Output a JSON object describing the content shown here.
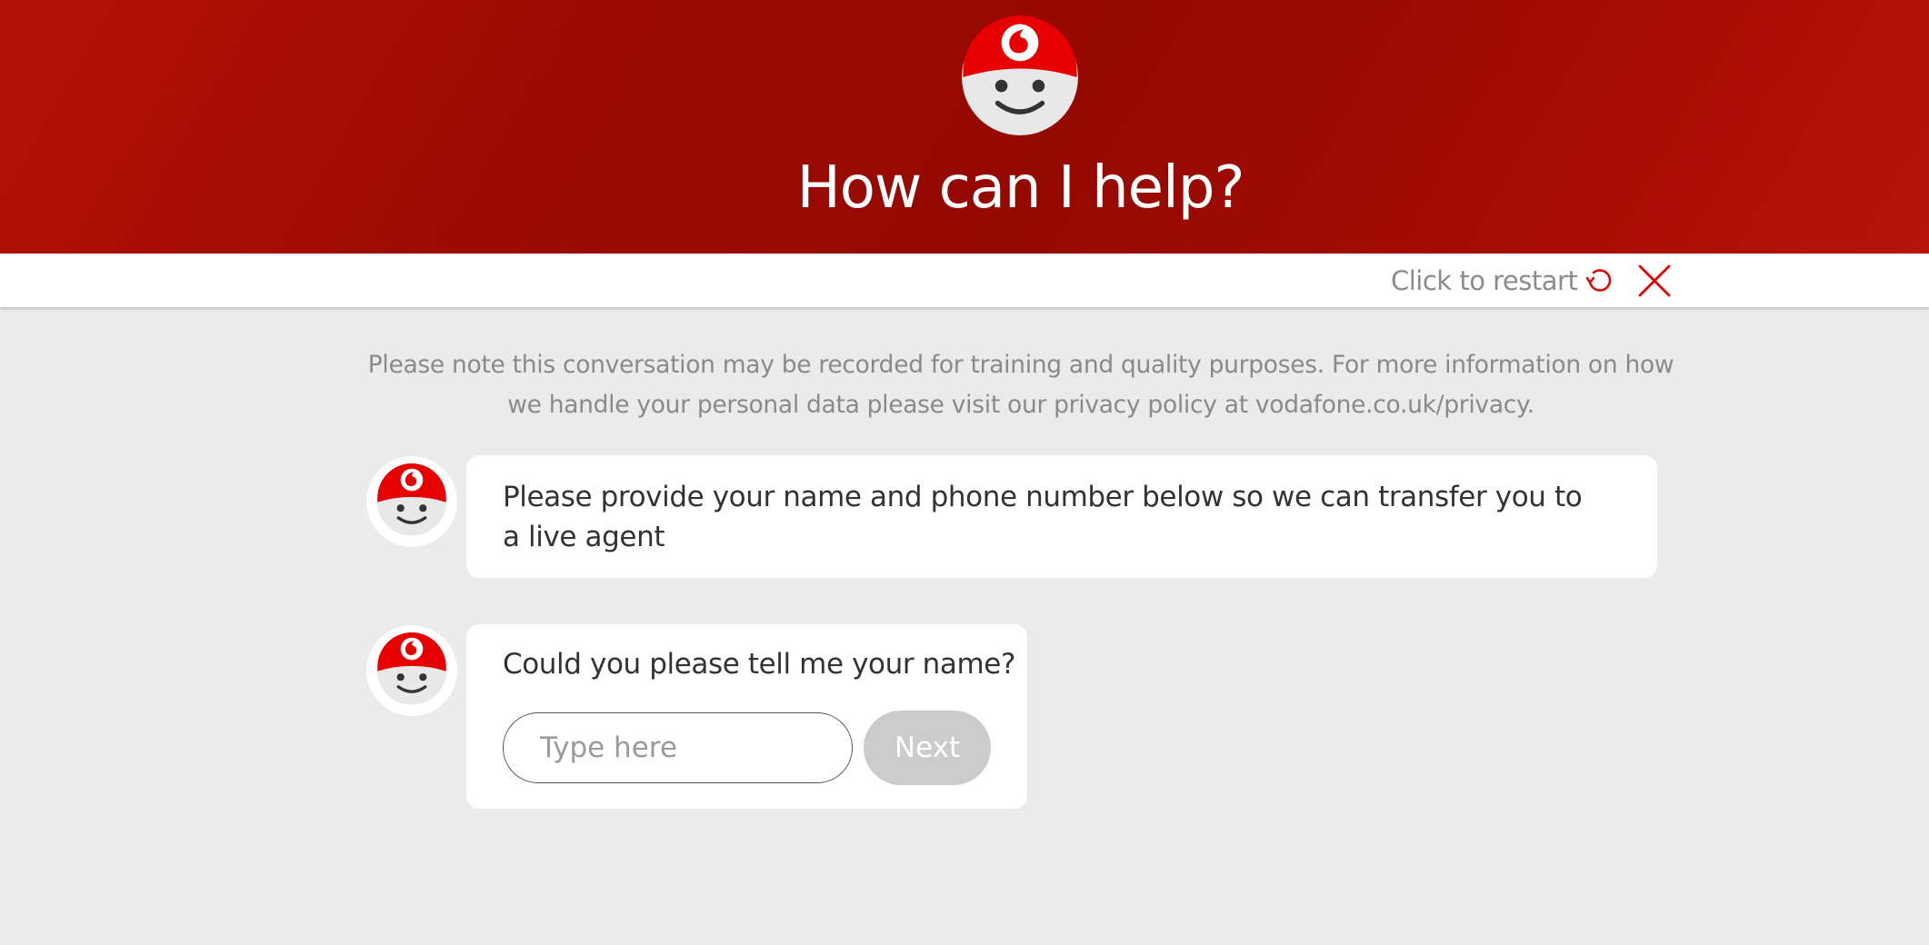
{
  "header": {
    "title": "How can I help?",
    "logo_icon": "vodafone-bot-icon"
  },
  "toolbar": {
    "restart_label": "Click to restart",
    "restart_icon": "restart-icon",
    "close_icon": "close-icon"
  },
  "notice": {
    "text": "Please note this conversation may be recorded for training and quality purposes. For more information on how we handle your personal data please visit our privacy policy at vodafone.co.uk/privacy."
  },
  "messages": [
    {
      "avatar": "bot-avatar-icon",
      "text": "Please provide your name and phone number below so we can transfer you to a live agent"
    },
    {
      "avatar": "bot-avatar-icon",
      "text": "Could you please tell me your name?",
      "input": {
        "value": "",
        "placeholder": "Type here"
      },
      "button_label": "Next"
    }
  ],
  "colors": {
    "brand_red": "#e60000",
    "header_red": "#a00a04",
    "background": "#ebebeb",
    "button_disabled": "#cccccc"
  }
}
